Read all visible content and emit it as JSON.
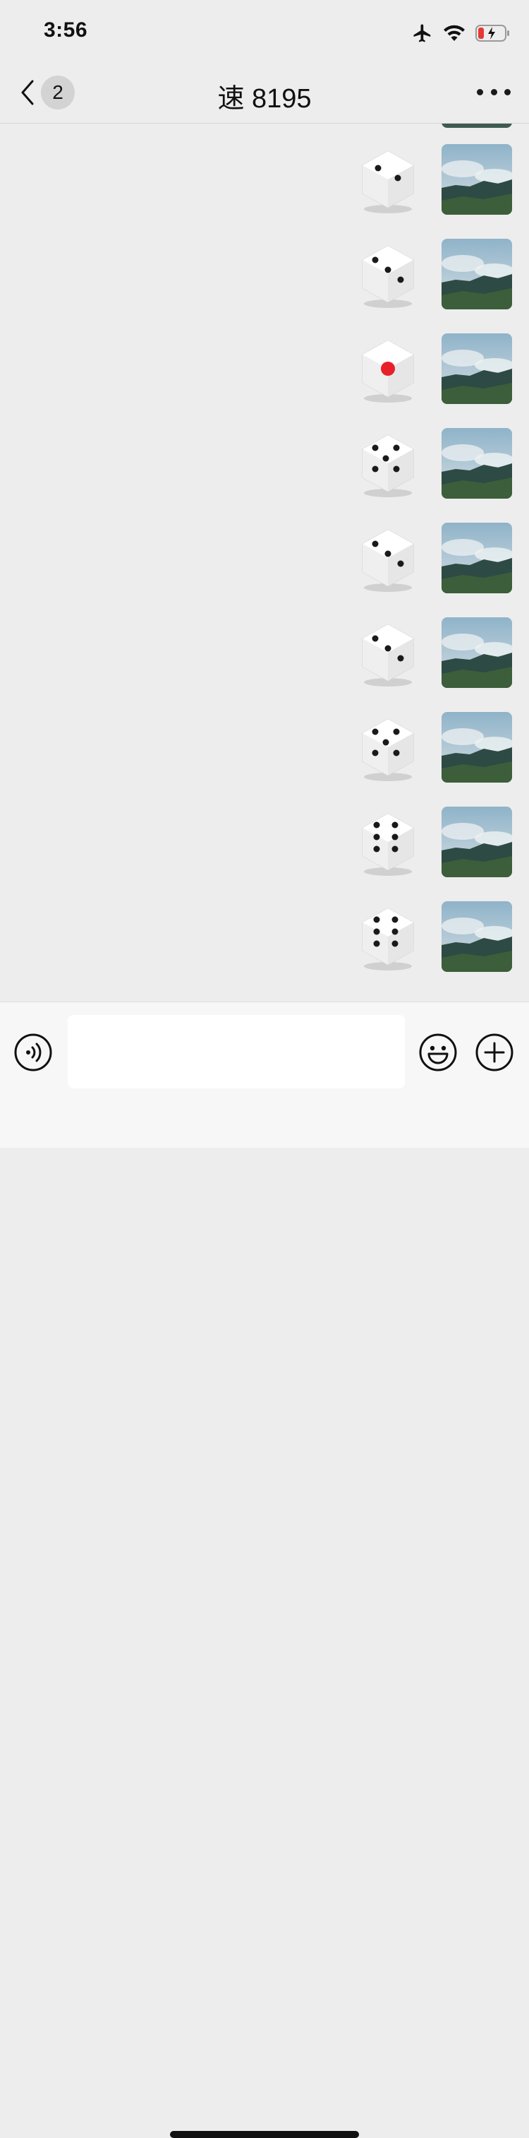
{
  "status_bar": {
    "time": "3:56",
    "icons": [
      "airplane-icon",
      "wifi-icon",
      "battery-low-charging-icon"
    ],
    "battery_color": "#e53935"
  },
  "nav": {
    "back_icon": "chevron-left-icon",
    "unread_count": "2",
    "title": "速 8195",
    "more_icon": "more-horizontal-icon"
  },
  "messages": [
    {
      "sender": "me",
      "type": "dice",
      "face": 2
    },
    {
      "sender": "me",
      "type": "dice",
      "face": 3
    },
    {
      "sender": "me",
      "type": "dice",
      "face": 1
    },
    {
      "sender": "me",
      "type": "dice",
      "face": 5
    },
    {
      "sender": "me",
      "type": "dice",
      "face": 3
    },
    {
      "sender": "me",
      "type": "dice",
      "face": 3
    },
    {
      "sender": "me",
      "type": "dice",
      "face": 5
    },
    {
      "sender": "me",
      "type": "dice",
      "face": 6
    },
    {
      "sender": "me",
      "type": "dice",
      "face": 6
    }
  ],
  "avatar": {
    "icon": "avatar-landscape-mountains",
    "sky": "#b9cdd8",
    "hill": "#2e4a44"
  },
  "input_bar": {
    "voice_icon": "voice-mode-icon",
    "text_value": "",
    "emoji_icon": "emoji-smile-icon",
    "plus_icon": "plus-circle-icon"
  },
  "colors": {
    "background": "#ededed",
    "dice_red": "#e8202a",
    "dice_pip": "#1a1a1a"
  }
}
